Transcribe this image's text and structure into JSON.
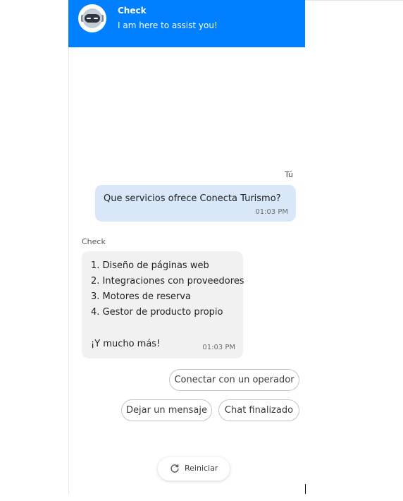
{
  "header": {
    "bot_name": "Check",
    "subtitle": "I am here to assist you!",
    "background_color": "#0080ff",
    "avatar_icon": "robot-icon"
  },
  "messages": {
    "user": {
      "sender": "Tú",
      "text": "Que servicios ofrece Conecta Turismo?",
      "time": "01:03 PM",
      "bubble_color": "#d8e8f8"
    },
    "bot": {
      "sender": "Check",
      "lines": [
        "1. Diseño de páginas web",
        "2. Integraciones con proveedores",
        "3. Motores de reserva",
        "4. Gestor de producto propio",
        "",
        "¡Y mucho más!"
      ],
      "time": "01:03 PM",
      "bubble_color": "#f1f1f1"
    }
  },
  "quick_replies": {
    "operator": "Conectar con un operador",
    "leave_message": "Dejar un mensaje",
    "chat_ended": "Chat finalizado"
  },
  "reset": {
    "label": "Reiniciar",
    "icon": "refresh-icon"
  }
}
